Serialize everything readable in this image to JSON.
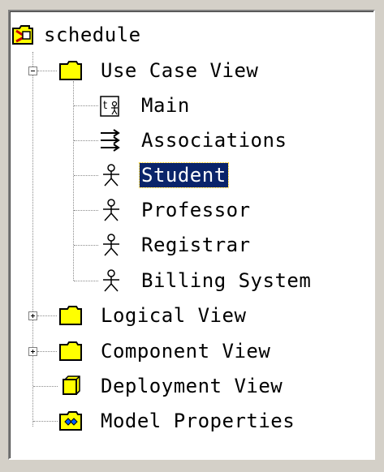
{
  "tree": {
    "root": {
      "label": "schedule",
      "icon": "model-root-icon"
    },
    "use_case_view": {
      "label": "Use Case View",
      "icon": "folder-icon",
      "expanded": true,
      "children": [
        {
          "label": "Main",
          "icon": "use-case-diagram-icon"
        },
        {
          "label": "Associations",
          "icon": "associations-icon"
        },
        {
          "label": "Student",
          "icon": "actor-icon",
          "selected": true
        },
        {
          "label": "Professor",
          "icon": "actor-icon"
        },
        {
          "label": "Registrar",
          "icon": "actor-icon"
        },
        {
          "label": "Billing System",
          "icon": "actor-icon"
        }
      ]
    },
    "logical_view": {
      "label": "Logical View",
      "icon": "folder-icon",
      "expanded": false
    },
    "component_view": {
      "label": "Component View",
      "icon": "folder-icon",
      "expanded": false
    },
    "deployment_view": {
      "label": "Deployment View",
      "icon": "deployment-node-icon"
    },
    "model_properties": {
      "label": "Model Properties",
      "icon": "model-properties-icon"
    }
  },
  "colors": {
    "selection_bg": "#0a246a",
    "selection_fg": "#ffffff",
    "folder_fill": "#ffff00",
    "window_bg": "#d4d0c8"
  }
}
